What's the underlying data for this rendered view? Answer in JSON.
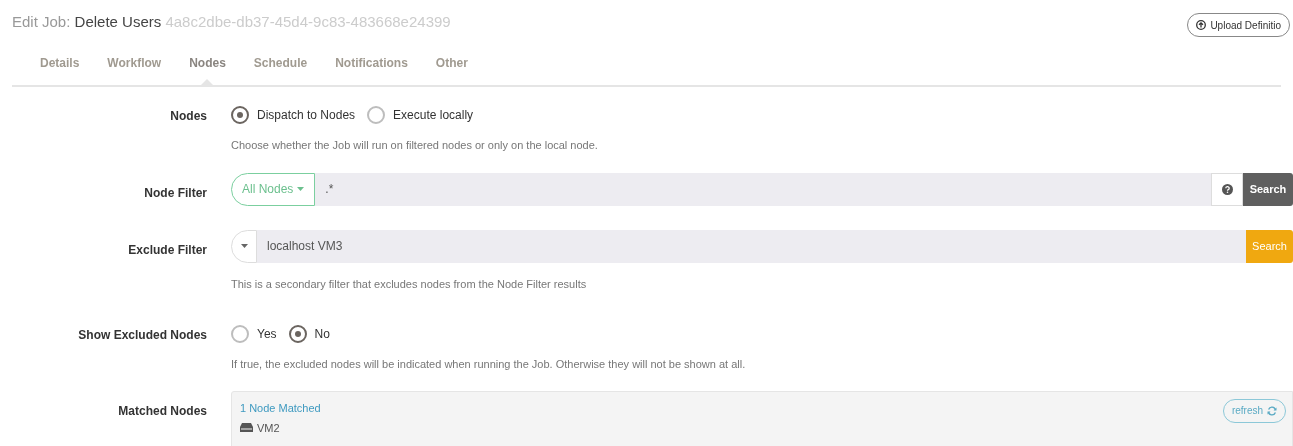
{
  "header": {
    "prefix": "Edit Job:",
    "job_name": "Delete Users",
    "job_id": "4a8c2dbe-db37-45d4-9c83-483668e24399",
    "upload_button": "Upload Definitio"
  },
  "tabs": [
    {
      "label": "Details",
      "selected": false
    },
    {
      "label": "Workflow",
      "selected": false
    },
    {
      "label": "Nodes",
      "selected": true
    },
    {
      "label": "Schedule",
      "selected": false
    },
    {
      "label": "Notifications",
      "selected": false
    },
    {
      "label": "Other",
      "selected": false
    }
  ],
  "form": {
    "nodes": {
      "label": "Nodes",
      "options": [
        {
          "label": "Dispatch to Nodes",
          "selected": true
        },
        {
          "label": "Execute locally",
          "selected": false
        }
      ],
      "help": "Choose whether the Job will run on filtered nodes or only on the local node."
    },
    "node_filter": {
      "label": "Node Filter",
      "dropdown": "All Nodes",
      "value": ".*",
      "button": "Search"
    },
    "exclude_filter": {
      "label": "Exclude Filter",
      "value": "localhost VM3",
      "button": "Search",
      "help": "This is a secondary filter that excludes nodes from the Node Filter results"
    },
    "show_excluded": {
      "label": "Show Excluded Nodes",
      "options": [
        {
          "label": "Yes",
          "selected": false
        },
        {
          "label": "No",
          "selected": true
        }
      ],
      "help": "If true, the excluded nodes will be indicated when running the Job. Otherwise they will not be shown at all."
    },
    "matched": {
      "label": "Matched Nodes",
      "count": "1 Node Matched",
      "refresh": "refresh",
      "nodes": [
        "VM2"
      ]
    }
  }
}
